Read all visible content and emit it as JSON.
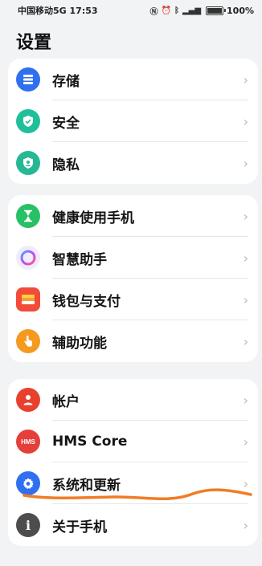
{
  "status": {
    "carrier": "中国移动5G",
    "time": "17:53",
    "battery": "100%",
    "indicator_icons": [
      "nfc-icon",
      "alarm-icon",
      "bluetooth-icon",
      "signal-icon",
      "wifi-icon"
    ]
  },
  "title": "设置",
  "groups": [
    {
      "items": [
        {
          "label": "存储",
          "icon": "storage-icon",
          "color": "#2f6ff0"
        },
        {
          "label": "安全",
          "icon": "shield-icon",
          "color": "#1fbf9b"
        },
        {
          "label": "隐私",
          "icon": "privacy-icon",
          "color": "#26b894"
        }
      ]
    },
    {
      "items": [
        {
          "label": "健康使用手机",
          "icon": "hourglass-icon",
          "color": "#28c067"
        },
        {
          "label": "智慧助手",
          "icon": "assistant-icon",
          "color": "#f0ecfb"
        },
        {
          "label": "钱包与支付",
          "icon": "wallet-icon",
          "color": "#f24b3a"
        },
        {
          "label": "辅助功能",
          "icon": "hand-icon",
          "color": "#f59a1e"
        }
      ]
    },
    {
      "items": [
        {
          "label": "帐户",
          "icon": "account-icon",
          "color": "#e8402f"
        },
        {
          "label": "HMS Core",
          "icon": "hms-icon",
          "color": "#e53f3a",
          "icon_text": "HMS"
        },
        {
          "label": "系统和更新",
          "icon": "gear-icon",
          "color": "#2f6ff0"
        },
        {
          "label": "关于手机",
          "icon": "info-icon",
          "color": "#4d4d4d",
          "icon_text": "i"
        }
      ]
    }
  ],
  "chevron": "›",
  "annotation_color": "#f07c26"
}
